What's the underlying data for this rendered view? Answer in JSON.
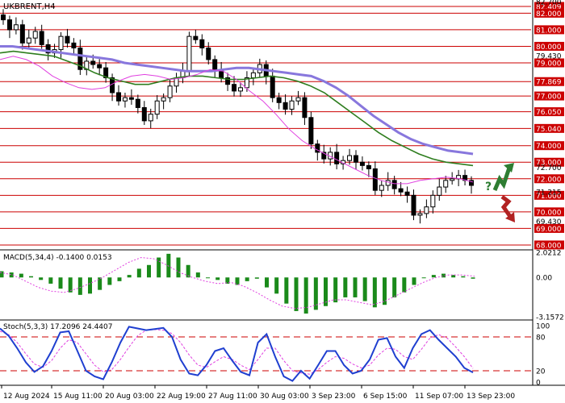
{
  "symbol_label": "UKBRENT,H4",
  "macd_label": "MACD(5,34,4) -0.1400 0.0153",
  "stoch_label": "Stoch(5,3,3) 17.2096 24.4407",
  "colors": {
    "candle": "#000000",
    "resistance_line": "#cc0000",
    "ma_fast": "#e040e0",
    "ma_mid": "#2e7d1e",
    "ma_slow": "#8877dd",
    "macd_hist": "#1a8a1a",
    "macd_signal": "#e040e0",
    "stoch_main": "#1f3fd0",
    "stoch_signal": "#e040e0",
    "price_tag_bg": "#cc0000",
    "up_arrow": "#2e7d32",
    "down_arrow": "#b22222"
  },
  "price_axis": {
    "min": 67.9,
    "max": 82.7,
    "highlighted_labels": [
      "82.409",
      "82.000",
      "81.000",
      "80.000",
      "79.000",
      "77.869",
      "77.000",
      "76.050",
      "75.040",
      "74.000",
      "73.000",
      "72.000",
      "71.000",
      "70.000",
      "69.000",
      "68.000"
    ],
    "plain_labels": [
      "82.700",
      "79.430",
      "72.700",
      "71.215",
      "69.430"
    ]
  },
  "resistance_levels": [
    82.409,
    82.0,
    81.0,
    80.0,
    79.0,
    77.869,
    77.0,
    76.05,
    75.04,
    74.0,
    73.0,
    72.0,
    71.0,
    70.0,
    69.0,
    68.0
  ],
  "macd_axis": {
    "labels": [
      "2.0212",
      "0.00",
      "-3.1572"
    ],
    "max": 2.0212,
    "min": -3.1572
  },
  "stoch_axis": {
    "labels": [
      "100",
      "80",
      "20",
      "0"
    ],
    "levels": [
      80,
      20
    ]
  },
  "time_axis": [
    "12 Aug 2024",
    "15 Aug 11:00",
    "20 Aug 03:00",
    "22 Aug 19:00",
    "27 Aug 11:00",
    "30 Aug 03:00",
    "3 Sep 23:00",
    "6 Sep 15:00",
    "11 Sep 07:00",
    "13 Sep 23:00"
  ],
  "scenario_marker": "?",
  "chart_data": {
    "type": "candlestick",
    "title": "UKBRENT,H4",
    "price_range": [
      67.9,
      82.7
    ],
    "close_series": [
      81.6,
      81.0,
      81.3,
      80.2,
      80.5,
      80.9,
      80.1,
      79.6,
      79.8,
      80.6,
      80.2,
      79.9,
      78.6,
      79.1,
      78.9,
      78.7,
      78.1,
      77.2,
      76.7,
      76.9,
      76.8,
      76.3,
      75.5,
      75.9,
      76.7,
      76.9,
      77.6,
      78.1,
      78.5,
      80.6,
      80.4,
      79.9,
      79.2,
      78.6,
      78.1,
      77.7,
      77.3,
      77.5,
      78.1,
      78.4,
      78.9,
      78.2,
      76.9,
      76.6,
      76.2,
      76.7,
      76.9,
      75.7,
      74.1,
      73.6,
      73.2,
      73.6,
      72.9,
      73.1,
      73.4,
      73.0,
      72.8,
      72.6,
      71.3,
      71.6,
      71.9,
      71.4,
      71.2,
      71.0,
      69.8,
      69.9,
      70.3,
      71.0,
      71.5,
      71.9,
      72.0,
      72.2,
      71.9,
      71.6
    ],
    "ma_slow": [
      80.0,
      80.0,
      79.9,
      79.8,
      79.7,
      79.6,
      79.5,
      79.4,
      79.3,
      79.2,
      79.0,
      78.9,
      78.8,
      78.7,
      78.6,
      78.5,
      78.5,
      78.5,
      78.6,
      78.7,
      78.7,
      78.6,
      78.5,
      78.4,
      78.3,
      78.2,
      77.9,
      77.5,
      77.0,
      76.4,
      75.8,
      75.3,
      74.8,
      74.4,
      74.1,
      73.9,
      73.7,
      73.6,
      73.5
    ],
    "ma_mid": [
      79.6,
      79.7,
      79.6,
      79.5,
      79.4,
      79.1,
      78.8,
      78.4,
      78.1,
      77.9,
      77.7,
      77.7,
      77.9,
      78.1,
      78.2,
      78.2,
      78.1,
      78.0,
      78.0,
      78.1,
      78.2,
      78.1,
      77.9,
      77.6,
      77.2,
      76.6,
      76.0,
      75.4,
      74.8,
      74.3,
      73.9,
      73.5,
      73.2,
      73.0,
      72.9,
      72.8
    ],
    "ma_fast": [
      79.2,
      79.4,
      79.2,
      78.8,
      78.2,
      77.8,
      77.5,
      77.4,
      77.5,
      77.9,
      78.2,
      78.3,
      78.2,
      78.0,
      78.1,
      78.3,
      78.6,
      78.5,
      78.0,
      77.3,
      76.7,
      75.9,
      75.0,
      74.3,
      73.8,
      73.4,
      73.0,
      72.6,
      72.2,
      71.9,
      71.7,
      71.7,
      71.9,
      72.0,
      72.1,
      72.0,
      71.8
    ],
    "macd_histogram": [
      0.5,
      0.4,
      0.3,
      0.1,
      -0.2,
      -0.5,
      -0.9,
      -1.2,
      -1.4,
      -1.3,
      -1.0,
      -0.6,
      -0.3,
      0.2,
      0.7,
      1.0,
      1.6,
      1.9,
      1.6,
      1.0,
      0.4,
      0.0,
      -0.2,
      -0.5,
      -0.6,
      -0.3,
      -0.1,
      -0.8,
      -1.3,
      -2.1,
      -2.7,
      -2.9,
      -2.6,
      -2.3,
      -2.0,
      -1.6,
      -1.6,
      -1.9,
      -2.4,
      -2.2,
      -1.6,
      -1.2,
      -0.6,
      0.0,
      0.2,
      0.3,
      0.2,
      0.1,
      -0.1
    ],
    "macd_signal": [
      0.4,
      0.2,
      -0.3,
      -0.8,
      -1.1,
      -1.2,
      -0.9,
      -0.5,
      0.0,
      0.6,
      1.2,
      1.6,
      1.5,
      1.0,
      0.4,
      0.0,
      -0.3,
      -0.5,
      -0.4,
      -0.7,
      -1.2,
      -1.8,
      -2.3,
      -2.5,
      -2.4,
      -2.1,
      -1.8,
      -1.8,
      -2.0,
      -2.2,
      -1.9,
      -1.4,
      -0.9,
      -0.4,
      0.0,
      0.2,
      0.2,
      0.1
    ],
    "stoch_k": [
      95,
      82,
      60,
      35,
      18,
      28,
      55,
      88,
      90,
      55,
      20,
      10,
      5,
      35,
      70,
      98,
      95,
      92,
      94,
      96,
      80,
      40,
      15,
      12,
      30,
      55,
      60,
      38,
      18,
      12,
      70,
      85,
      45,
      10,
      2,
      20,
      6,
      30,
      55,
      55,
      30,
      15,
      20,
      40,
      75,
      78,
      45,
      25,
      60,
      85,
      92,
      75,
      60,
      45,
      25,
      17
    ],
    "stoch_d": [
      90,
      84,
      70,
      50,
      32,
      26,
      38,
      60,
      75,
      70,
      50,
      30,
      18,
      22,
      40,
      62,
      82,
      92,
      93,
      92,
      86,
      70,
      48,
      30,
      26,
      36,
      45,
      40,
      30,
      22,
      40,
      60,
      60,
      38,
      20,
      16,
      14,
      22,
      35,
      45,
      42,
      32,
      25,
      30,
      48,
      60,
      58,
      45,
      40,
      58,
      78,
      84,
      78,
      62,
      45,
      24
    ],
    "x_ticks": [
      "12 Aug 2024",
      "15 Aug 11:00",
      "20 Aug 03:00",
      "22 Aug 19:00",
      "27 Aug 11:00",
      "30 Aug 03:00",
      "3 Sep 23:00",
      "6 Sep 15:00",
      "11 Sep 07:00",
      "13 Sep 23:00"
    ]
  }
}
